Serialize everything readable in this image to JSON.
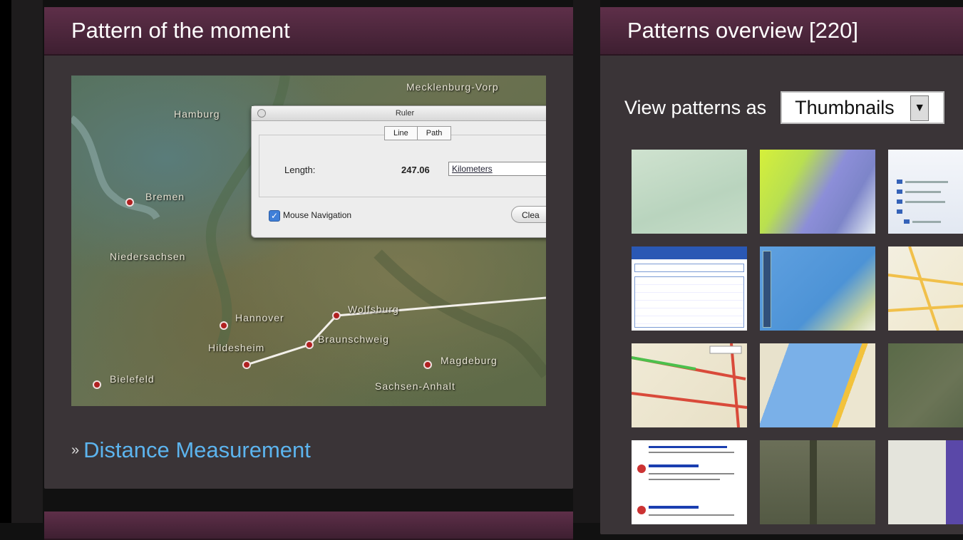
{
  "moment_panel": {
    "title": "Pattern of the moment",
    "link_label": "Distance Measurement",
    "map": {
      "labels": {
        "hamburg": "Hamburg",
        "mecklenburg": "Mecklenburg-Vorp",
        "bremen": "Bremen",
        "niedersachsen": "Niedersachsen",
        "hannover": "Hannover",
        "wolfsburg": "Wolfsburg",
        "braunschweig": "Braunschweig",
        "hildesheim": "Hildesheim",
        "magdeburg": "Magdeburg",
        "bielefeld": "Bielefeld",
        "sachsen_anhalt": "Sachsen-Anhalt"
      },
      "ruler": {
        "title": "Ruler",
        "tab_line": "Line",
        "tab_path": "Path",
        "length_label": "Length:",
        "length_value": "247.06",
        "units": "Kilometers",
        "mouse_navigation": "Mouse Navigation",
        "clear_button": "Clea"
      }
    }
  },
  "overview_panel": {
    "title": "Patterns overview [220]",
    "view_as_label": "View patterns as",
    "view_select_value": "Thumbnails"
  },
  "colors": {
    "header_top": "#5e2f49",
    "header_bottom": "#3e1f31",
    "panel_bg": "#3a3437",
    "link": "#5cb4ee"
  }
}
